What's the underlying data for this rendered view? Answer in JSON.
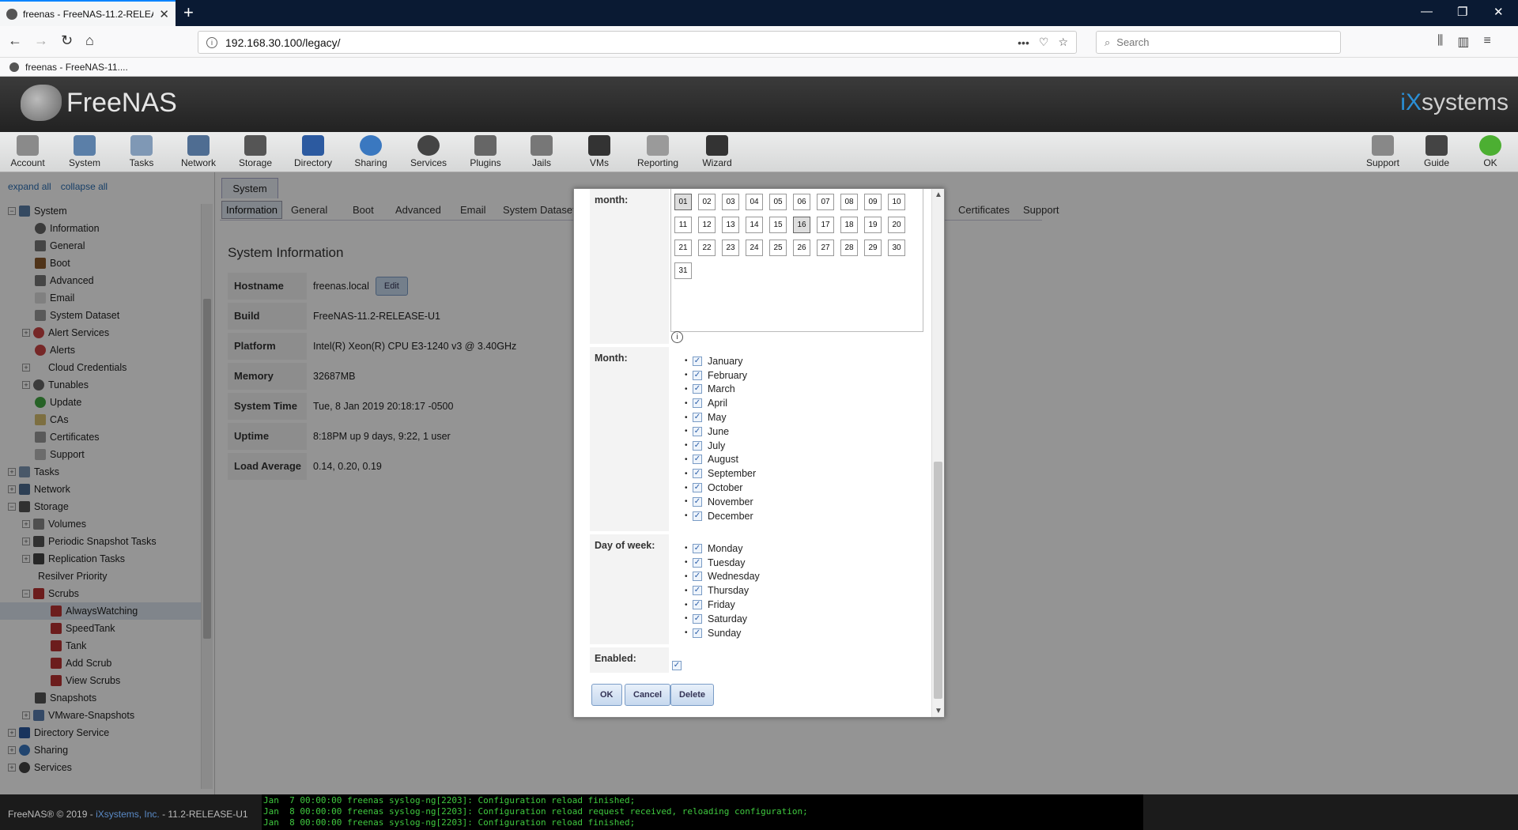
{
  "browser": {
    "tab_title": "freenas - FreeNAS-11.2-RELEAS",
    "url": "192.168.30.100/legacy/",
    "search_placeholder": "Search",
    "bookmark": "freenas - FreeNAS-11...."
  },
  "header": {
    "logo": "FreeNAS",
    "vendor": "systems",
    "vendor_prefix": "iX"
  },
  "toolbar": {
    "items": [
      "Account",
      "System",
      "Tasks",
      "Network",
      "Storage",
      "Directory",
      "Sharing",
      "Services",
      "Plugins",
      "Jails",
      "VMs",
      "Reporting",
      "Wizard"
    ],
    "right_items": [
      "Support",
      "Guide",
      "OK"
    ]
  },
  "sidebar": {
    "expand_all": "expand all",
    "collapse_all": "collapse all",
    "items": [
      {
        "label": "System"
      },
      {
        "label": "Information"
      },
      {
        "label": "General"
      },
      {
        "label": "Boot"
      },
      {
        "label": "Advanced"
      },
      {
        "label": "Email"
      },
      {
        "label": "System Dataset"
      },
      {
        "label": "Alert Services"
      },
      {
        "label": "Alerts"
      },
      {
        "label": "Cloud Credentials"
      },
      {
        "label": "Tunables"
      },
      {
        "label": "Update"
      },
      {
        "label": "CAs"
      },
      {
        "label": "Certificates"
      },
      {
        "label": "Support"
      },
      {
        "label": "Tasks"
      },
      {
        "label": "Network"
      },
      {
        "label": "Storage"
      },
      {
        "label": "Volumes"
      },
      {
        "label": "Periodic Snapshot Tasks"
      },
      {
        "label": "Replication Tasks"
      },
      {
        "label": "Resilver Priority"
      },
      {
        "label": "Scrubs"
      },
      {
        "label": "AlwaysWatching"
      },
      {
        "label": "SpeedTank"
      },
      {
        "label": "Tank"
      },
      {
        "label": "Add Scrub"
      },
      {
        "label": "View Scrubs"
      },
      {
        "label": "Snapshots"
      },
      {
        "label": "VMware-Snapshots"
      },
      {
        "label": "Directory Service"
      },
      {
        "label": "Sharing"
      },
      {
        "label": "Services"
      }
    ]
  },
  "main": {
    "section_tab": "System",
    "tabs": [
      "Information",
      "General",
      "Boot",
      "Advanced",
      "Email",
      "System Dataset",
      "Certificates",
      "Support"
    ],
    "title": "System Information",
    "edit_label": "Edit",
    "info": [
      {
        "label": "Hostname",
        "value": "freenas.local"
      },
      {
        "label": "Build",
        "value": "FreeNAS-11.2-RELEASE-U1"
      },
      {
        "label": "Platform",
        "value": "Intel(R) Xeon(R) CPU E3-1240 v3 @ 3.40GHz"
      },
      {
        "label": "Memory",
        "value": "32687MB"
      },
      {
        "label": "System Time",
        "value": "Tue, 8 Jan 2019 20:18:17 -0500"
      },
      {
        "label": "Uptime",
        "value": "8:18PM up 9 days, 9:22, 1 user"
      },
      {
        "label": "Load Average",
        "value": "0.14, 0.20, 0.19"
      }
    ]
  },
  "dialog": {
    "day_label": "month:",
    "days": [
      "01",
      "02",
      "03",
      "04",
      "05",
      "06",
      "07",
      "08",
      "09",
      "10",
      "11",
      "12",
      "13",
      "14",
      "15",
      "16",
      "17",
      "18",
      "19",
      "20",
      "21",
      "22",
      "23",
      "24",
      "25",
      "26",
      "27",
      "28",
      "29",
      "30",
      "31"
    ],
    "selected_days": [
      "01",
      "16"
    ],
    "month_label": "Month:",
    "months": [
      "January",
      "February",
      "March",
      "April",
      "May",
      "June",
      "July",
      "August",
      "September",
      "October",
      "November",
      "December"
    ],
    "dow_label": "Day of week:",
    "weekdays": [
      "Monday",
      "Tuesday",
      "Wednesday",
      "Thursday",
      "Friday",
      "Saturday",
      "Sunday"
    ],
    "enabled_label": "Enabled:",
    "enabled": true,
    "ok": "OK",
    "cancel": "Cancel",
    "delete": "Delete"
  },
  "footer": {
    "copyright_prefix": "FreeNAS® © 2019 - ",
    "company": "iXsystems, Inc.",
    "copyright_suffix": " - 11.2-RELEASE-U1",
    "log_lines": [
      "Jan  7 00:00:00 freenas syslog-ng[2203]: Configuration reload finished;",
      "Jan  8 00:00:00 freenas syslog-ng[2203]: Configuration reload request received, reloading configuration;",
      "Jan  8 00:00:00 freenas syslog-ng[2203]: Configuration reload finished;"
    ]
  }
}
